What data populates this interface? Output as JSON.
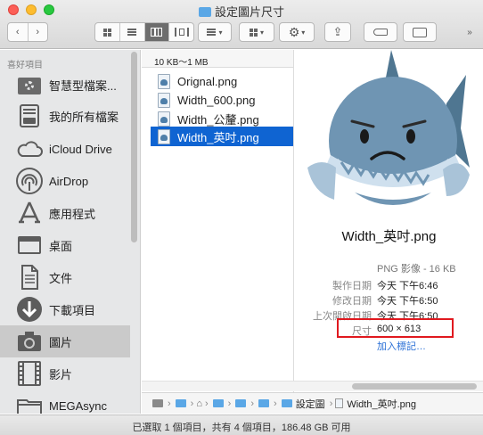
{
  "window": {
    "title": "設定圖片尺寸"
  },
  "toolbar": {
    "back_icon": "chevron-left-icon",
    "forward_icon": "chevron-right-icon",
    "view_modes": [
      "icon-view",
      "list-view",
      "column-view",
      "cover-flow-view"
    ],
    "active_view": "column-view",
    "arrange_icon": "arrange-icon",
    "group_icon": "group-icon",
    "action_icon": "gear-icon",
    "share_icon": "share-icon",
    "tag_icon": "tag-icon",
    "new_folder_icon": "new-folder-icon",
    "expand_icon": "expand-icon"
  },
  "sidebar": {
    "section_header": "喜好項目",
    "items": [
      {
        "label": "智慧型檔案...",
        "icon": "smart-folder-icon"
      },
      {
        "label": "我的所有檔案",
        "icon": "all-files-icon"
      },
      {
        "label": "iCloud Drive",
        "icon": "cloud-icon"
      },
      {
        "label": "AirDrop",
        "icon": "airdrop-icon"
      },
      {
        "label": "應用程式",
        "icon": "applications-icon"
      },
      {
        "label": "桌面",
        "icon": "desktop-icon"
      },
      {
        "label": "文件",
        "icon": "document-icon"
      },
      {
        "label": "下載項目",
        "icon": "downloads-icon"
      },
      {
        "label": "圖片",
        "icon": "camera-icon",
        "selected": true
      },
      {
        "label": "影片",
        "icon": "film-icon"
      },
      {
        "label": "MEGAsync",
        "icon": "folder-icon"
      }
    ]
  },
  "column": {
    "header": "10 KB～1 MB",
    "files": [
      {
        "name": "Orignal.png"
      },
      {
        "name": "Width_600.png"
      },
      {
        "name": "Width_公釐.png"
      },
      {
        "name": "Width_英吋.png",
        "selected": true
      }
    ]
  },
  "preview": {
    "file_name": "Width_英吋.png",
    "kind": "PNG 影像 - 16 KB",
    "rows": [
      {
        "key": "製作日期",
        "value": "今天 下午6:46"
      },
      {
        "key": "修改日期",
        "value": "今天 下午6:50"
      },
      {
        "key": "上次開啟日期",
        "value": "今天 下午6:50"
      },
      {
        "key": "尺寸",
        "value": "600 × 613"
      }
    ],
    "add_tags": "加入標記…",
    "highlight_color": "#e0191f"
  },
  "pathbar": {
    "segments": [
      "設定圖",
      "Width_英吋.png"
    ]
  },
  "status": {
    "text": "已選取 1 個項目，共有 4 個項目，186.48 GB 可用"
  }
}
